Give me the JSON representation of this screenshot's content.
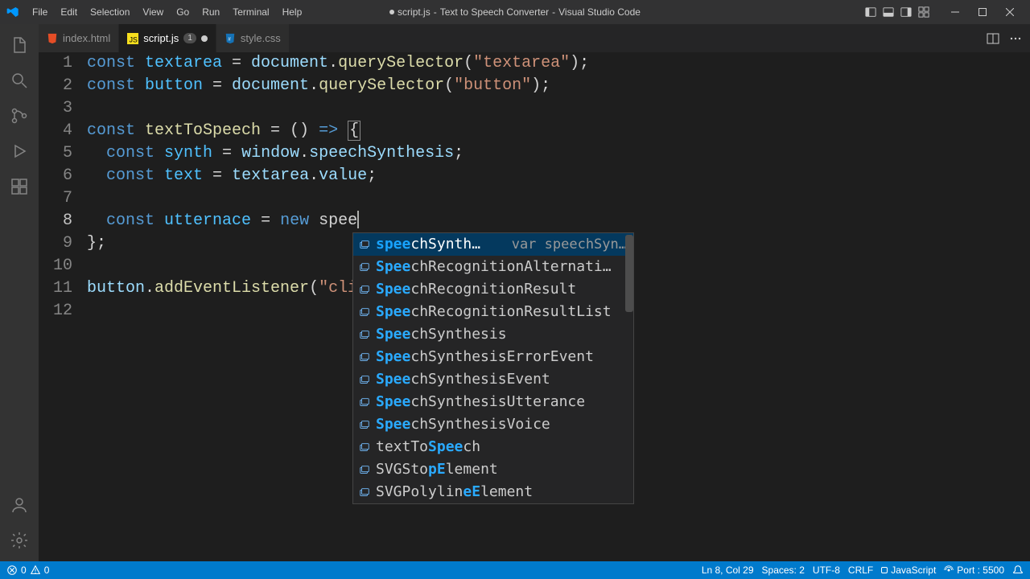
{
  "title": {
    "filename": "script.js",
    "project": "Text to Speech Converter",
    "app": "Visual Studio Code"
  },
  "menu": [
    "File",
    "Edit",
    "Selection",
    "View",
    "Go",
    "Run",
    "Terminal",
    "Help"
  ],
  "tabs": [
    {
      "icon": "html",
      "name": "index.html",
      "active": false,
      "dirty": false
    },
    {
      "icon": "js",
      "name": "script.js",
      "active": true,
      "dirty": true,
      "badge": "1"
    },
    {
      "icon": "css",
      "name": "style.css",
      "active": false,
      "dirty": false
    }
  ],
  "code": {
    "lines": [
      {
        "n": 1,
        "segments": [
          {
            "t": "const ",
            "c": "k"
          },
          {
            "t": "textarea",
            "c": "v"
          },
          {
            "t": " = ",
            "c": "o"
          },
          {
            "t": "document",
            "c": "p"
          },
          {
            "t": ".",
            "c": "o"
          },
          {
            "t": "querySelector",
            "c": "f"
          },
          {
            "t": "(",
            "c": "o"
          },
          {
            "t": "\"textarea\"",
            "c": "s"
          },
          {
            "t": ");",
            "c": "o"
          }
        ]
      },
      {
        "n": 2,
        "segments": [
          {
            "t": "const ",
            "c": "k"
          },
          {
            "t": "button",
            "c": "v"
          },
          {
            "t": " = ",
            "c": "o"
          },
          {
            "t": "document",
            "c": "p"
          },
          {
            "t": ".",
            "c": "o"
          },
          {
            "t": "querySelector",
            "c": "f"
          },
          {
            "t": "(",
            "c": "o"
          },
          {
            "t": "\"button\"",
            "c": "s"
          },
          {
            "t": ");",
            "c": "o"
          }
        ]
      },
      {
        "n": 3,
        "segments": []
      },
      {
        "n": 4,
        "segments": [
          {
            "t": "const ",
            "c": "k"
          },
          {
            "t": "textToSpeech",
            "c": "f"
          },
          {
            "t": " = () ",
            "c": "o"
          },
          {
            "t": "=>",
            "c": "k"
          },
          {
            "t": " ",
            "c": "o"
          },
          {
            "t": "{",
            "c": "o",
            "bracket": true
          }
        ]
      },
      {
        "n": 5,
        "segments": [
          {
            "t": "  ",
            "c": "o"
          },
          {
            "t": "const ",
            "c": "k"
          },
          {
            "t": "synth",
            "c": "v"
          },
          {
            "t": " = ",
            "c": "o"
          },
          {
            "t": "window",
            "c": "p"
          },
          {
            "t": ".",
            "c": "o"
          },
          {
            "t": "speechSynthesis",
            "c": "p"
          },
          {
            "t": ";",
            "c": "o"
          }
        ]
      },
      {
        "n": 6,
        "segments": [
          {
            "t": "  ",
            "c": "o"
          },
          {
            "t": "const ",
            "c": "k"
          },
          {
            "t": "text",
            "c": "v"
          },
          {
            "t": " = ",
            "c": "o"
          },
          {
            "t": "textarea",
            "c": "p"
          },
          {
            "t": ".",
            "c": "o"
          },
          {
            "t": "value",
            "c": "p"
          },
          {
            "t": ";",
            "c": "o"
          }
        ]
      },
      {
        "n": 7,
        "segments": []
      },
      {
        "n": 8,
        "current": true,
        "segments": [
          {
            "t": "  ",
            "c": "o"
          },
          {
            "t": "const ",
            "c": "k"
          },
          {
            "t": "utternace",
            "c": "v"
          },
          {
            "t": " = ",
            "c": "o"
          },
          {
            "t": "new ",
            "c": "k"
          },
          {
            "t": "spee",
            "c": "n"
          }
        ],
        "cursor": true
      },
      {
        "n": 9,
        "segments": [
          {
            "t": "}",
            "c": "o"
          },
          {
            "t": ";",
            "c": "o"
          }
        ]
      },
      {
        "n": 10,
        "segments": []
      },
      {
        "n": 11,
        "segments": [
          {
            "t": "button",
            "c": "p"
          },
          {
            "t": ".",
            "c": "o"
          },
          {
            "t": "addEventListener",
            "c": "f"
          },
          {
            "t": "(",
            "c": "o"
          },
          {
            "t": "\"cli",
            "c": "s"
          }
        ]
      },
      {
        "n": 12,
        "segments": []
      }
    ]
  },
  "suggest": {
    "items": [
      {
        "pre": "",
        "hl": "spee",
        "post": "chSynth…",
        "detail": "var speechSyn…",
        "selected": true
      },
      {
        "pre": "",
        "hl": "Spee",
        "post": "chRecognitionAlternati…"
      },
      {
        "pre": "",
        "hl": "Spee",
        "post": "chRecognitionResult"
      },
      {
        "pre": "",
        "hl": "Spee",
        "post": "chRecognitionResultList"
      },
      {
        "pre": "",
        "hl": "Spee",
        "post": "chSynthesis"
      },
      {
        "pre": "",
        "hl": "Spee",
        "post": "chSynthesisErrorEvent"
      },
      {
        "pre": "",
        "hl": "Spee",
        "post": "chSynthesisEvent"
      },
      {
        "pre": "",
        "hl": "Spee",
        "post": "chSynthesisUtterance"
      },
      {
        "pre": "",
        "hl": "Spee",
        "post": "chSynthesisVoice"
      },
      {
        "pre": "textTo",
        "hl": "Spee",
        "post": "ch"
      },
      {
        "pre": "SVGSto",
        "hl": "pE",
        "post": "lement"
      },
      {
        "pre": "SVGPolylin",
        "hl": "eE",
        "post": "lement"
      }
    ]
  },
  "status": {
    "errors": "0",
    "warnings": "0",
    "line_col": "Ln 8, Col 29",
    "spaces": "Spaces: 2",
    "encoding": "UTF-8",
    "eol": "CRLF",
    "lang": "JavaScript",
    "port": "Port : 5500",
    "bell": ""
  }
}
